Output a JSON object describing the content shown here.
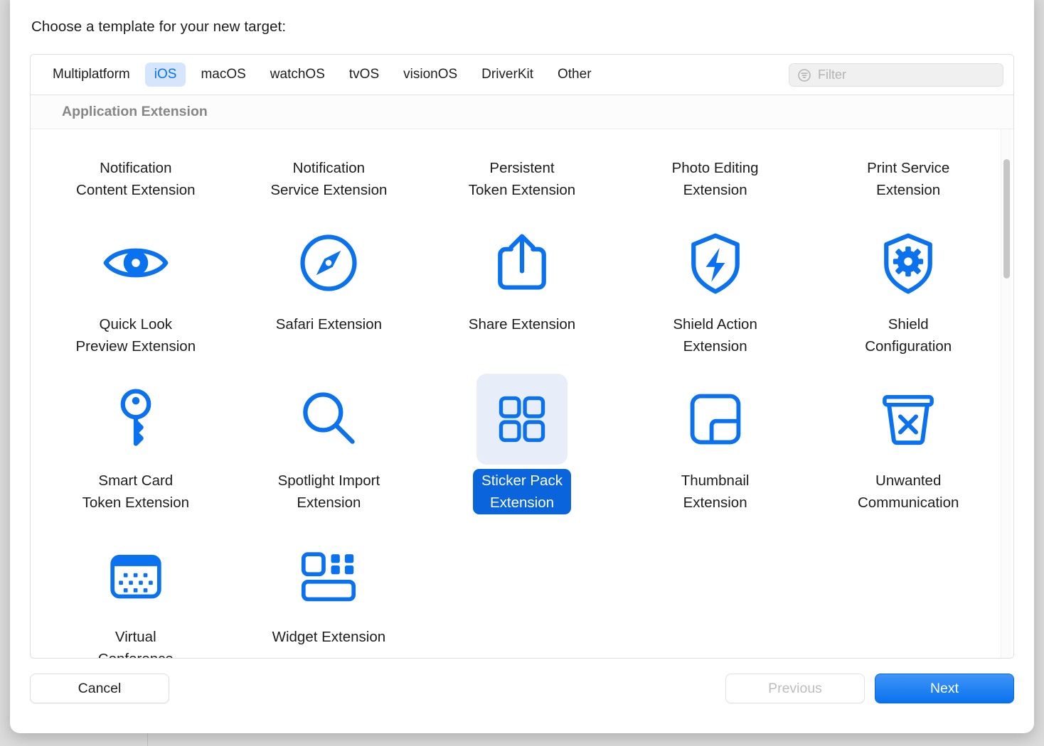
{
  "dialog": {
    "title": "Choose a template for your new target:"
  },
  "tabs": [
    {
      "label": "Multiplatform",
      "selected": false
    },
    {
      "label": "iOS",
      "selected": true
    },
    {
      "label": "macOS",
      "selected": false
    },
    {
      "label": "watchOS",
      "selected": false
    },
    {
      "label": "tvOS",
      "selected": false
    },
    {
      "label": "visionOS",
      "selected": false
    },
    {
      "label": "DriverKit",
      "selected": false
    },
    {
      "label": "Other",
      "selected": false
    }
  ],
  "filter": {
    "placeholder": "Filter",
    "value": "",
    "icon": "filter-icon"
  },
  "section": {
    "header": "Application Extension"
  },
  "templates": [
    {
      "label": "Notification\nContent Extension",
      "icon": "none",
      "selected": false
    },
    {
      "label": "Notification\nService Extension",
      "icon": "none",
      "selected": false
    },
    {
      "label": "Persistent\nToken Extension",
      "icon": "none",
      "selected": false
    },
    {
      "label": "Photo Editing\nExtension",
      "icon": "none",
      "selected": false
    },
    {
      "label": "Print Service\nExtension",
      "icon": "none",
      "selected": false
    },
    {
      "label": "Quick Look\nPreview Extension",
      "icon": "eye-icon",
      "selected": false
    },
    {
      "label": "Safari Extension",
      "icon": "compass-icon",
      "selected": false
    },
    {
      "label": "Share Extension",
      "icon": "share-icon",
      "selected": false
    },
    {
      "label": "Shield Action\nExtension",
      "icon": "shield-bolt-icon",
      "selected": false
    },
    {
      "label": "Shield\nConfiguration",
      "icon": "shield-gear-icon",
      "selected": false
    },
    {
      "label": "Smart Card\nToken Extension",
      "icon": "key-icon",
      "selected": false
    },
    {
      "label": "Spotlight Import\nExtension",
      "icon": "magnifier-icon",
      "selected": false
    },
    {
      "label": "Sticker Pack\nExtension",
      "icon": "grid-squares-icon",
      "selected": true
    },
    {
      "label": "Thumbnail\nExtension",
      "icon": "thumbnail-icon",
      "selected": false
    },
    {
      "label": "Unwanted\nCommunication",
      "icon": "trash-x-icon",
      "selected": false
    },
    {
      "label": "Virtual\nConference",
      "icon": "calendar-icon",
      "selected": false
    },
    {
      "label": "Widget Extension",
      "icon": "widget-icon",
      "selected": false
    },
    {
      "label": "",
      "icon": "none",
      "selected": false
    },
    {
      "label": "",
      "icon": "none",
      "selected": false
    },
    {
      "label": "",
      "icon": "none",
      "selected": false
    }
  ],
  "footer": {
    "cancel": "Cancel",
    "previous": "Previous",
    "next": "Next"
  },
  "colors": {
    "accent_blue": "#0a72ef",
    "selected_label_blue": "#0a64dc",
    "selected_icon_bg": "#e7eefa",
    "tab_selected_bg": "#d4e5fc",
    "section_header_gray": "#868686",
    "disabled_gray": "#bdbdbd"
  }
}
